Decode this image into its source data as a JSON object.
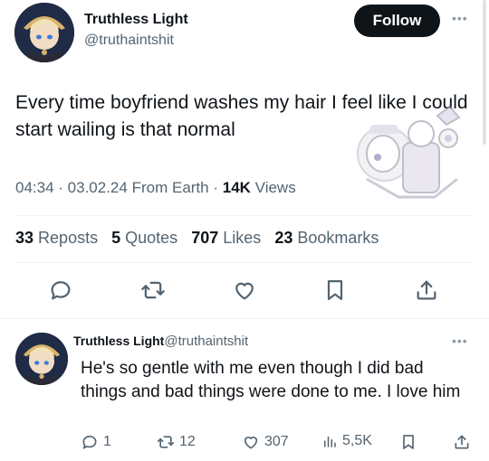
{
  "tweet": {
    "author_name": "Truthless Light",
    "author_handle": "@truthaintshit",
    "follow_label": "Follow",
    "text": "Every time boyfriend washes my hair I feel like I could start wailing is that normal",
    "time": "04:34",
    "date": "03.02.24",
    "location": "From Earth",
    "views_count": "14K",
    "views_label": "Views",
    "reposts_count": "33",
    "reposts_label": "Reposts",
    "quotes_count": "5",
    "quotes_label": "Quotes",
    "likes_count": "707",
    "likes_label": "Likes",
    "bookmarks_count": "23",
    "bookmarks_label": "Bookmarks"
  },
  "reply": {
    "author_name": "Truthless Light",
    "author_handle": "@truthaintshit",
    "text": "He's so gentle with me even though I did bad things and bad things were done to me. I love him",
    "replies": "1",
    "reposts": "12",
    "likes": "307",
    "views": "5,5K"
  },
  "colors": {
    "text_primary": "#0f1419",
    "text_secondary": "#536471",
    "follow_bg": "#0f1419",
    "divider": "#eff3f4"
  },
  "icons": [
    "more-icon",
    "reply-icon",
    "repost-icon",
    "like-icon",
    "bookmark-icon",
    "share-icon",
    "views-icon"
  ]
}
